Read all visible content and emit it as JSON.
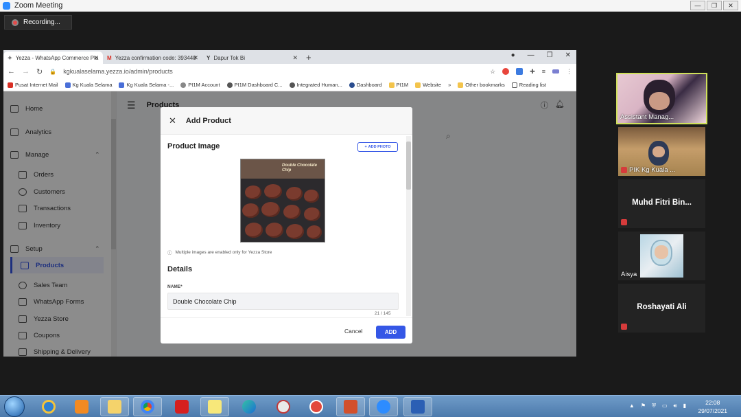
{
  "zoom": {
    "window_title": "Zoom Meeting",
    "recording_label": "Recording...",
    "window_controls": [
      "—",
      "❐",
      "✕"
    ]
  },
  "browser": {
    "tabs": [
      {
        "icon": "✧",
        "label": "Yezza - WhatsApp Commerce Pla",
        "active": true
      },
      {
        "icon": "M",
        "label": "Yezza confirmation code: 393448",
        "active": false
      },
      {
        "icon": "Y",
        "label": "Dapur Tok Bi",
        "active": false
      }
    ],
    "new_tab": "+",
    "url": "kgkualaselama.yezza.io/admin/products",
    "bookmarks": [
      "Pusat Internet Mail",
      "Kg Kuala Selama",
      "Kg Kuala Selama -...",
      "PI1M Account",
      "PI1M Dashboard C...",
      "Integrated Human...",
      "Dashboard",
      "PI1M",
      "Website",
      "»",
      "Other bookmarks",
      "Reading list"
    ]
  },
  "sidebar": {
    "items": [
      {
        "label": "Home",
        "kind": "top"
      },
      {
        "label": "Analytics",
        "kind": "top"
      },
      {
        "label": "Manage",
        "kind": "section"
      },
      {
        "label": "Orders",
        "kind": "sub"
      },
      {
        "label": "Customers",
        "kind": "sub"
      },
      {
        "label": "Transactions",
        "kind": "sub"
      },
      {
        "label": "Inventory",
        "kind": "sub"
      },
      {
        "label": "Setup",
        "kind": "section"
      },
      {
        "label": "Products",
        "kind": "sub",
        "active": true
      },
      {
        "label": "Sales Team",
        "kind": "sub"
      },
      {
        "label": "WhatsApp Forms",
        "kind": "sub"
      },
      {
        "label": "Yezza Store",
        "kind": "sub"
      },
      {
        "label": "Coupons",
        "kind": "sub"
      },
      {
        "label": "Shipping & Delivery",
        "kind": "sub"
      }
    ]
  },
  "main": {
    "page_title": "Products"
  },
  "modal": {
    "title": "Add Product",
    "image_section": "Product Image",
    "add_photo": "ADD PHOTO",
    "photo_caption": "Double Chocolate Chip",
    "note": "Multiple images are enabled only for Yezza Store",
    "details_section": "Details",
    "name_label": "NAME*",
    "name_value": "Double Chocolate Chip",
    "name_counter": "21 / 145",
    "cancel_label": "Cancel",
    "add_label": "ADD"
  },
  "participants": [
    {
      "name": "Assistant Manag...",
      "speaking": true,
      "video": true,
      "muted": false
    },
    {
      "name": "PIK Kg Kuala ...",
      "speaking": false,
      "video": true,
      "muted": true
    },
    {
      "name": "Muhd Fitri Bin...",
      "speaking": false,
      "video": false,
      "muted": true
    },
    {
      "name": "Aisya",
      "speaking": false,
      "video": true,
      "muted": false
    },
    {
      "name": "Roshayati Ali",
      "speaking": false,
      "video": false,
      "muted": true
    }
  ],
  "taskbar": {
    "time": "22:08",
    "date": "29/07/2021"
  },
  "colors": {
    "accent": "#3557e6",
    "speaker_border": "#cfe05a",
    "muted": "#d63b3b"
  }
}
